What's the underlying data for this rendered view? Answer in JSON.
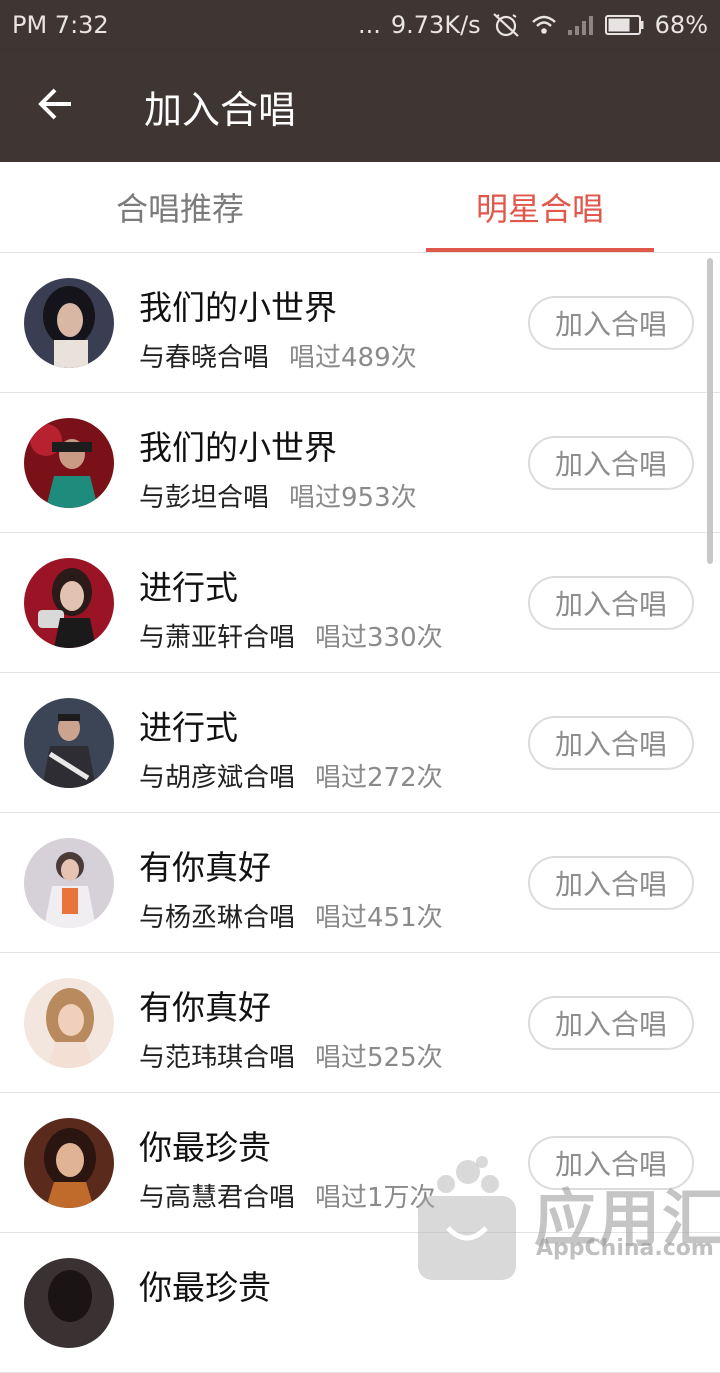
{
  "status_bar": {
    "time": "PM 7:32",
    "dots": "...",
    "speed": "9.73K/s",
    "battery": "68%"
  },
  "app_bar": {
    "title": "加入合唱",
    "back_icon": "arrow-left-icon"
  },
  "tabs": [
    {
      "label": "合唱推荐",
      "active": false
    },
    {
      "label": "明星合唱",
      "active": true
    }
  ],
  "colors": {
    "app_bar": "#3f3634",
    "accent": "#e0574c"
  },
  "rows": [
    {
      "song": "我们的小世界",
      "with": "与春晓合唱",
      "count": "唱过489次",
      "button": "加入合唱"
    },
    {
      "song": "我们的小世界",
      "with": "与彭坦合唱",
      "count": "唱过953次",
      "button": "加入合唱"
    },
    {
      "song": "进行式",
      "with": "与萧亚轩合唱",
      "count": "唱过330次",
      "button": "加入合唱"
    },
    {
      "song": "进行式",
      "with": "与胡彦斌合唱",
      "count": "唱过272次",
      "button": "加入合唱"
    },
    {
      "song": "有你真好",
      "with": "与杨丞琳合唱",
      "count": "唱过451次",
      "button": "加入合唱"
    },
    {
      "song": "有你真好",
      "with": "与范玮琪合唱",
      "count": "唱过525次",
      "button": "加入合唱"
    },
    {
      "song": "你最珍贵",
      "with": "与高慧君合唱",
      "count": "唱过1万次",
      "button": "加入合唱"
    },
    {
      "song": "你最珍贵",
      "with": "",
      "count": "",
      "button": ""
    }
  ],
  "watermark": {
    "name": "应用汇",
    "site": "AppChina.com"
  }
}
